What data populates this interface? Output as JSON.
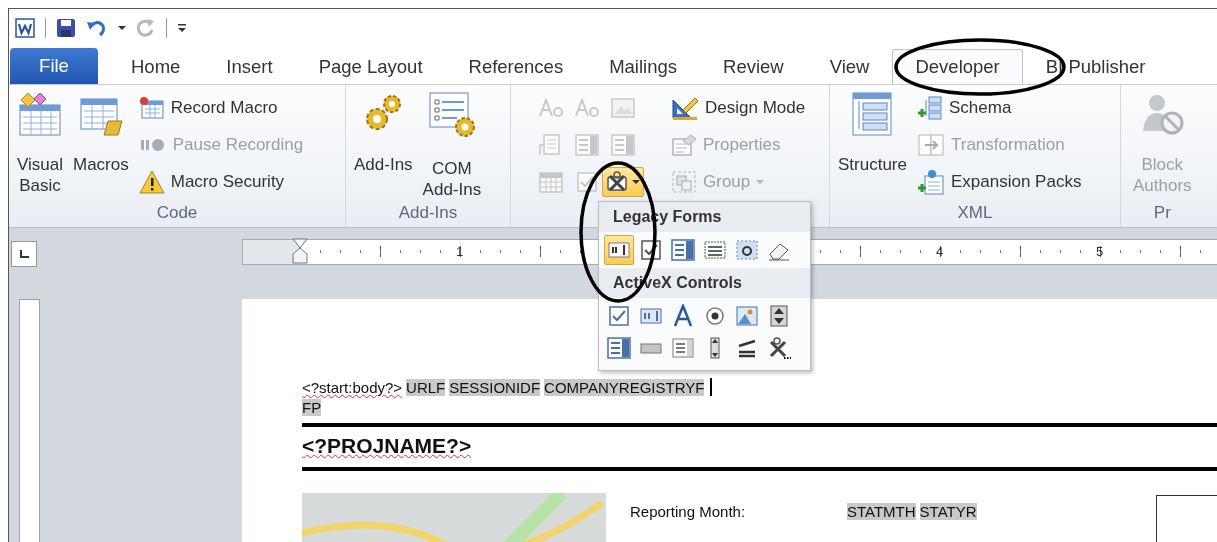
{
  "tabs": [
    {
      "label": "File",
      "kind": "file",
      "selected": false
    },
    {
      "label": "Home",
      "kind": "tab",
      "selected": false
    },
    {
      "label": "Insert",
      "kind": "tab",
      "selected": false
    },
    {
      "label": "Page Layout",
      "kind": "tab",
      "selected": false
    },
    {
      "label": "References",
      "kind": "tab",
      "selected": false
    },
    {
      "label": "Mailings",
      "kind": "tab",
      "selected": false
    },
    {
      "label": "Review",
      "kind": "tab",
      "selected": false
    },
    {
      "label": "View",
      "kind": "tab",
      "selected": false
    },
    {
      "label": "Developer",
      "kind": "tab",
      "selected": true
    },
    {
      "label": "BI Publisher",
      "kind": "tab",
      "selected": false
    }
  ],
  "ribbon": {
    "groups": [
      {
        "label": "Code",
        "items": [
          {
            "kind": "large",
            "lines": [
              "Visual",
              "Basic"
            ],
            "disabled": false
          },
          {
            "kind": "large",
            "lines": [
              "Macros"
            ],
            "disabled": false
          },
          {
            "kind": "stack",
            "rows": [
              {
                "label": "Record Macro",
                "disabled": false
              },
              {
                "label": "Pause Recording",
                "disabled": true
              },
              {
                "label": "Macro Security",
                "disabled": false
              }
            ]
          }
        ]
      },
      {
        "label": "Add-Ins",
        "items": [
          {
            "kind": "large",
            "lines": [
              "Add-Ins"
            ],
            "disabled": false
          },
          {
            "kind": "large",
            "lines": [
              "COM",
              "Add-Ins"
            ],
            "disabled": false
          }
        ]
      },
      {
        "items": [
          {
            "kind": "grid",
            "cells": [
              {
                "disabled": true,
                "pressed": false
              },
              {
                "disabled": true,
                "pressed": false
              },
              {
                "disabled": true,
                "pressed": false
              },
              {
                "disabled": true,
                "pressed": false
              },
              {
                "disabled": true,
                "pressed": false
              },
              {
                "disabled": true,
                "pressed": false
              },
              {
                "disabled": true,
                "pressed": false
              },
              {
                "disabled": true,
                "pressed": false
              },
              {
                "disabled": false,
                "pressed": true
              }
            ]
          },
          {
            "kind": "stack",
            "rows": [
              {
                "label": "Design Mode",
                "disabled": false
              },
              {
                "label": "Properties",
                "disabled": true
              },
              {
                "label": "Group",
                "disabled": true,
                "dropdown": true
              }
            ]
          }
        ]
      },
      {
        "label": "XML",
        "items": [
          {
            "kind": "large",
            "lines": [
              "Structure"
            ],
            "disabled": false
          },
          {
            "kind": "stack",
            "rows": [
              {
                "label": "Schema",
                "disabled": false
              },
              {
                "label": "Transformation",
                "disabled": true
              },
              {
                "label": "Expansion Packs",
                "disabled": false
              }
            ]
          }
        ]
      },
      {
        "label": "Pr",
        "items": [
          {
            "kind": "large",
            "lines": [
              "Block",
              "Authors"
            ],
            "disabled": true
          }
        ]
      }
    ]
  },
  "ruler": {
    "numbers": [
      "1",
      "4",
      "5"
    ]
  },
  "popup": {
    "sections": [
      {
        "title": "Legacy Forms",
        "items": [
          {
            "selected": true
          },
          {
            "selected": false
          },
          {
            "selected": false
          },
          {
            "selected": false
          },
          {
            "selected": false
          },
          {
            "selected": false
          }
        ]
      },
      {
        "title": "ActiveX Controls",
        "items": [
          {
            "selected": false
          },
          {
            "selected": false
          },
          {
            "selected": false
          },
          {
            "selected": false
          },
          {
            "selected": false
          },
          {
            "selected": false
          },
          {
            "selected": false
          },
          {
            "selected": false
          },
          {
            "selected": false
          },
          {
            "selected": false
          },
          {
            "selected": false
          },
          {
            "selected": false
          }
        ]
      }
    ]
  },
  "document": {
    "blocks": [
      {
        "kind": "paragraph",
        "cursor": true,
        "segments": [
          {
            "text": "<?start:body?>",
            "field": false,
            "spell_error": true
          },
          {
            "text": "URLF",
            "field": true,
            "spell_error": false
          },
          {
            "text": "SESSIONIDF",
            "field": true,
            "spell_error": false
          },
          {
            "text": "COMPANYREGISTRYF",
            "field": true,
            "spell_error": false
          }
        ]
      },
      {
        "kind": "paragraph",
        "cursor": false,
        "segments": [
          {
            "text": "FP",
            "field": true,
            "spell_error": false
          }
        ]
      },
      {
        "kind": "rule"
      },
      {
        "kind": "heading",
        "segments": [
          {
            "text": "<?PROJNAME?>",
            "field": false,
            "spell_error": true
          }
        ]
      },
      {
        "kind": "rule"
      },
      {
        "kind": "info_row",
        "label": "Reporting Month:",
        "segments": [
          {
            "text": "STATMTH",
            "field": true,
            "spell_error": false
          },
          {
            "text": "STATYR",
            "field": true,
            "spell_error": false
          }
        ]
      }
    ]
  }
}
